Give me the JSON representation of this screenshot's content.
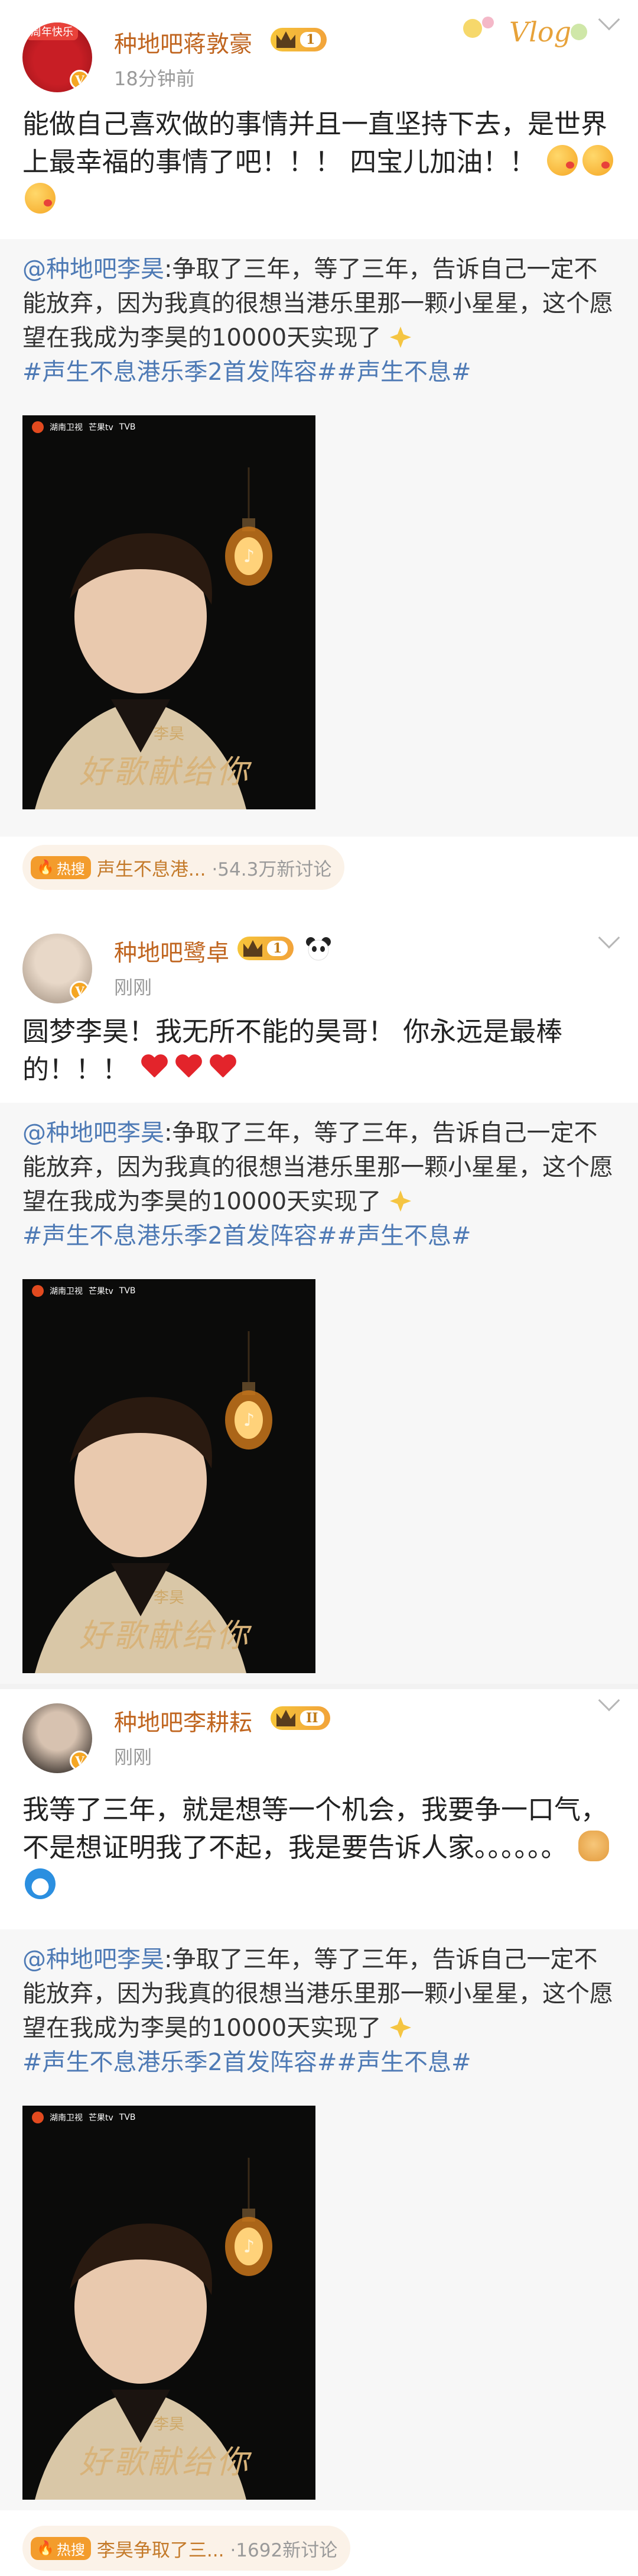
{
  "posts": [
    {
      "author": "种地吧蒋敦豪",
      "avatar_tag": "周年快乐",
      "verified_mark": "V",
      "level": "1",
      "time": "18分钟前",
      "vlog_deco_text": "Vlog",
      "text": "能做自己喜欢做的事情并且一直坚持下去，是世界上最幸福的事情了吧！！！ 四宝儿加油！！",
      "text_emojis": [
        "kiss-emoji",
        "kiss-emoji",
        "kiss-emoji"
      ],
      "repost": {
        "mention": "@种地吧李昊",
        "text": ":争取了三年，等了三年，告诉自己一定不能放弃，因为我真的很想当港乐里那一颗小星星，这个愿望在我成为李昊的10000天实现了",
        "hashtags": [
          "#声生不息港乐季2首发阵容#",
          "#声生不息#"
        ]
      },
      "topic": {
        "hot_label": "热搜",
        "title": "声生不息港...",
        "count": "·54.3万新讨论"
      }
    },
    {
      "author": "种地吧鹭卓",
      "verified_mark": "V",
      "level": "1",
      "time": "刚刚",
      "text": "圆梦李昊！我无所不能的昊哥！ 你永远是最棒的！！！",
      "repost": {
        "mention": "@种地吧李昊",
        "text": ":争取了三年，等了三年，告诉自己一定不能放弃，因为我真的很想当港乐里那一颗小星星，这个愿望在我成为李昊的10000天实现了",
        "hashtags": [
          "#声生不息港乐季2首发阵容#",
          "#声生不息#"
        ]
      }
    },
    {
      "author": "种地吧李耕耘",
      "verified_mark": "V",
      "level": "II",
      "time": "刚刚",
      "text": "我等了三年，就是想等一个机会，我要争一口气，不是想证明我了不起，我是要告诉人家。。。。。。",
      "repost": {
        "mention": "@种地吧李昊",
        "text": ":争取了三年，等了三年，告诉自己一定不能放弃，因为我真的很想当港乐里那一颗小星星，这个愿望在我成为李昊的10000天实现了",
        "hashtags": [
          "#声生不息港乐季2首发阵容#",
          "#声生不息#"
        ]
      },
      "topic": {
        "hot_label": "热搜",
        "title": "李昊争取了三...",
        "count": "·1692新讨论"
      }
    }
  ],
  "poster": {
    "name": "李昊",
    "title": "好歌献给你",
    "logos": [
      "湖南卫视",
      "芒果tv",
      "TVB"
    ]
  },
  "colors": {
    "author": "#c0651f",
    "link": "#4e7ab5",
    "topic_bg": "#fbf2e8",
    "hot": "#f39c2c"
  }
}
